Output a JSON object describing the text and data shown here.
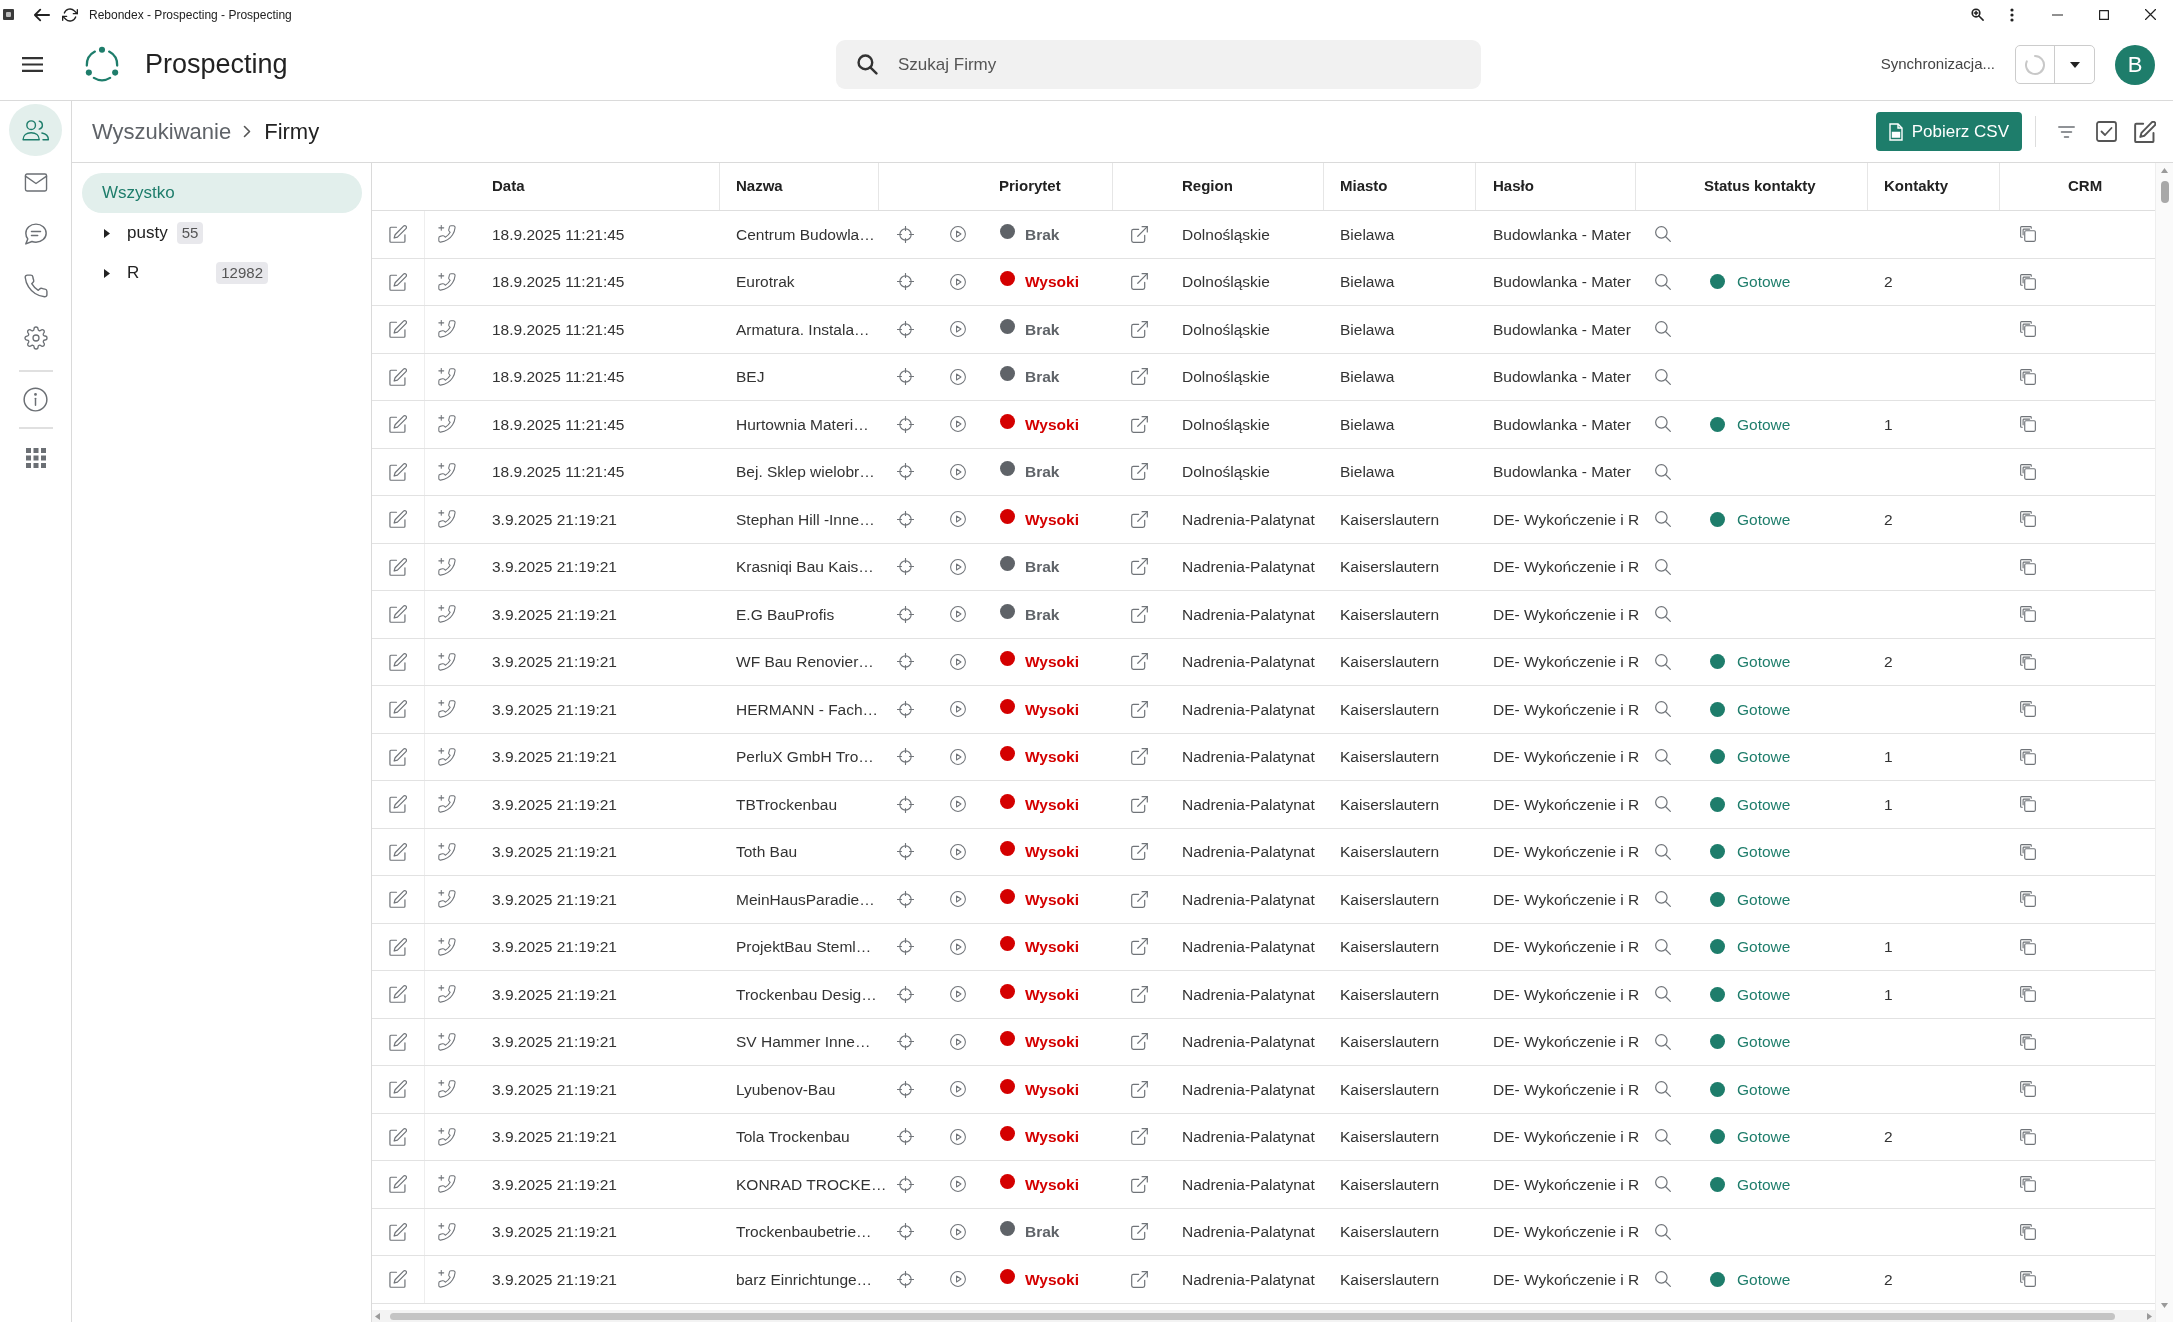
{
  "window": {
    "title": "Rebondex - Prospecting - Prospecting"
  },
  "app_bar": {
    "title": "Prospecting",
    "search": {
      "placeholder": "Szukaj Firmy"
    },
    "sync_label": "Synchronizacja...",
    "avatar": "B"
  },
  "nav_rail": [
    {
      "selected": true
    },
    {
      "selected": false
    },
    {
      "selected": false
    },
    {
      "selected": false
    },
    {
      "selected": false
    },
    {
      "selected": false
    },
    {
      "selected": false
    }
  ],
  "breadcrumb": [
    "Wyszukiwanie",
    "Firmy"
  ],
  "toolbar": {
    "export_button": "Pobierz CSV"
  },
  "filter_panel": {
    "items": [
      {
        "kind": "all",
        "label": "Wszystko",
        "selected": true
      },
      {
        "kind": "node",
        "label": "pusty",
        "count": "55",
        "selected": false,
        "expanded": false
      },
      {
        "kind": "node",
        "label": "R",
        "count": "12982",
        "selected": false,
        "expanded": false
      }
    ]
  },
  "table": {
    "columns": [
      "Data",
      "Nazwa",
      "Priorytet",
      "Region",
      "Miasto",
      "Hasło",
      "Status kontakty",
      "Kontakty",
      "CRM"
    ],
    "rows": [
      {
        "date": "18.9.2025 11:21:45",
        "name": "Centrum Budowla…",
        "priority": {
          "label": "Brak",
          "color": "#5f6368"
        },
        "region": "Dolnośląskie",
        "city": "Bielawa",
        "keyword": "Budowlanka - Mater"
      },
      {
        "date": "18.9.2025 11:21:45",
        "name": "Eurotrak",
        "priority": {
          "label": "Wysoki",
          "color": "#d40000"
        },
        "region": "Dolnośląskie",
        "city": "Bielawa",
        "keyword": "Budowlanka - Mater",
        "status": {
          "label": "Gotowe",
          "color": "#1e7d6b"
        },
        "contacts": "2"
      },
      {
        "date": "18.9.2025 11:21:45",
        "name": "Armatura. Instala…",
        "priority": {
          "label": "Brak",
          "color": "#5f6368"
        },
        "region": "Dolnośląskie",
        "city": "Bielawa",
        "keyword": "Budowlanka - Mater"
      },
      {
        "date": "18.9.2025 11:21:45",
        "name": "BEJ",
        "priority": {
          "label": "Brak",
          "color": "#5f6368"
        },
        "region": "Dolnośląskie",
        "city": "Bielawa",
        "keyword": "Budowlanka - Mater"
      },
      {
        "date": "18.9.2025 11:21:45",
        "name": "Hurtownia Materi…",
        "priority": {
          "label": "Wysoki",
          "color": "#d40000"
        },
        "region": "Dolnośląskie",
        "city": "Bielawa",
        "keyword": "Budowlanka - Mater",
        "status": {
          "label": "Gotowe",
          "color": "#1e7d6b"
        },
        "contacts": "1"
      },
      {
        "date": "18.9.2025 11:21:45",
        "name": "Bej. Sklep wielobr…",
        "priority": {
          "label": "Brak",
          "color": "#5f6368"
        },
        "region": "Dolnośląskie",
        "city": "Bielawa",
        "keyword": "Budowlanka - Mater"
      },
      {
        "date": "3.9.2025 21:19:21",
        "name": "Stephan Hill -Inne…",
        "priority": {
          "label": "Wysoki",
          "color": "#d40000"
        },
        "region": "Nadrenia-Palatynat",
        "city": "Kaiserslautern",
        "keyword": "DE- Wykończenie i R",
        "status": {
          "label": "Gotowe",
          "color": "#1e7d6b"
        },
        "contacts": "2"
      },
      {
        "date": "3.9.2025 21:19:21",
        "name": "Krasniqi Bau Kais…",
        "priority": {
          "label": "Brak",
          "color": "#5f6368"
        },
        "region": "Nadrenia-Palatynat",
        "city": "Kaiserslautern",
        "keyword": "DE- Wykończenie i R"
      },
      {
        "date": "3.9.2025 21:19:21",
        "name": "E.G BauProfis",
        "priority": {
          "label": "Brak",
          "color": "#5f6368"
        },
        "region": "Nadrenia-Palatynat",
        "city": "Kaiserslautern",
        "keyword": "DE- Wykończenie i R"
      },
      {
        "date": "3.9.2025 21:19:21",
        "name": "WF Bau Renovier…",
        "priority": {
          "label": "Wysoki",
          "color": "#d40000"
        },
        "region": "Nadrenia-Palatynat",
        "city": "Kaiserslautern",
        "keyword": "DE- Wykończenie i R",
        "status": {
          "label": "Gotowe",
          "color": "#1e7d6b"
        },
        "contacts": "2"
      },
      {
        "date": "3.9.2025 21:19:21",
        "name": "HERMANN - Fach…",
        "priority": {
          "label": "Wysoki",
          "color": "#d40000"
        },
        "region": "Nadrenia-Palatynat",
        "city": "Kaiserslautern",
        "keyword": "DE- Wykończenie i R",
        "status": {
          "label": "Gotowe",
          "color": "#1e7d6b"
        }
      },
      {
        "date": "3.9.2025 21:19:21",
        "name": "PerluX GmbH Tro…",
        "priority": {
          "label": "Wysoki",
          "color": "#d40000"
        },
        "region": "Nadrenia-Palatynat",
        "city": "Kaiserslautern",
        "keyword": "DE- Wykończenie i R",
        "status": {
          "label": "Gotowe",
          "color": "#1e7d6b"
        },
        "contacts": "1"
      },
      {
        "date": "3.9.2025 21:19:21",
        "name": "TBTrockenbau",
        "priority": {
          "label": "Wysoki",
          "color": "#d40000"
        },
        "region": "Nadrenia-Palatynat",
        "city": "Kaiserslautern",
        "keyword": "DE- Wykończenie i R",
        "status": {
          "label": "Gotowe",
          "color": "#1e7d6b"
        },
        "contacts": "1"
      },
      {
        "date": "3.9.2025 21:19:21",
        "name": "Toth Bau",
        "priority": {
          "label": "Wysoki",
          "color": "#d40000"
        },
        "region": "Nadrenia-Palatynat",
        "city": "Kaiserslautern",
        "keyword": "DE- Wykończenie i R",
        "status": {
          "label": "Gotowe",
          "color": "#1e7d6b"
        }
      },
      {
        "date": "3.9.2025 21:19:21",
        "name": "MeinHausParadie…",
        "priority": {
          "label": "Wysoki",
          "color": "#d40000"
        },
        "region": "Nadrenia-Palatynat",
        "city": "Kaiserslautern",
        "keyword": "DE- Wykończenie i R",
        "status": {
          "label": "Gotowe",
          "color": "#1e7d6b"
        }
      },
      {
        "date": "3.9.2025 21:19:21",
        "name": "ProjektBau Steml…",
        "priority": {
          "label": "Wysoki",
          "color": "#d40000"
        },
        "region": "Nadrenia-Palatynat",
        "city": "Kaiserslautern",
        "keyword": "DE- Wykończenie i R",
        "status": {
          "label": "Gotowe",
          "color": "#1e7d6b"
        },
        "contacts": "1"
      },
      {
        "date": "3.9.2025 21:19:21",
        "name": "Trockenbau Desig…",
        "priority": {
          "label": "Wysoki",
          "color": "#d40000"
        },
        "region": "Nadrenia-Palatynat",
        "city": "Kaiserslautern",
        "keyword": "DE- Wykończenie i R",
        "status": {
          "label": "Gotowe",
          "color": "#1e7d6b"
        },
        "contacts": "1"
      },
      {
        "date": "3.9.2025 21:19:21",
        "name": "SV Hammer Inne…",
        "priority": {
          "label": "Wysoki",
          "color": "#d40000"
        },
        "region": "Nadrenia-Palatynat",
        "city": "Kaiserslautern",
        "keyword": "DE- Wykończenie i R",
        "status": {
          "label": "Gotowe",
          "color": "#1e7d6b"
        }
      },
      {
        "date": "3.9.2025 21:19:21",
        "name": "Lyubenov-Bau",
        "priority": {
          "label": "Wysoki",
          "color": "#d40000"
        },
        "region": "Nadrenia-Palatynat",
        "city": "Kaiserslautern",
        "keyword": "DE- Wykończenie i R",
        "status": {
          "label": "Gotowe",
          "color": "#1e7d6b"
        }
      },
      {
        "date": "3.9.2025 21:19:21",
        "name": "Tola Trockenbau",
        "priority": {
          "label": "Wysoki",
          "color": "#d40000"
        },
        "region": "Nadrenia-Palatynat",
        "city": "Kaiserslautern",
        "keyword": "DE- Wykończenie i R",
        "status": {
          "label": "Gotowe",
          "color": "#1e7d6b"
        },
        "contacts": "2"
      },
      {
        "date": "3.9.2025 21:19:21",
        "name": "KONRAD TROCKE…",
        "priority": {
          "label": "Wysoki",
          "color": "#d40000"
        },
        "region": "Nadrenia-Palatynat",
        "city": "Kaiserslautern",
        "keyword": "DE- Wykończenie i R",
        "status": {
          "label": "Gotowe",
          "color": "#1e7d6b"
        }
      },
      {
        "date": "3.9.2025 21:19:21",
        "name": "Trockenbaubetrie…",
        "priority": {
          "label": "Brak",
          "color": "#5f6368"
        },
        "region": "Nadrenia-Palatynat",
        "city": "Kaiserslautern",
        "keyword": "DE- Wykończenie i R"
      },
      {
        "date": "3.9.2025 21:19:21",
        "name": "barz Einrichtunge…",
        "priority": {
          "label": "Wysoki",
          "color": "#d40000"
        },
        "region": "Nadrenia-Palatynat",
        "city": "Kaiserslautern",
        "keyword": "DE- Wykończenie i R",
        "status": {
          "label": "Gotowe",
          "color": "#1e7d6b"
        },
        "contacts": "2"
      }
    ]
  }
}
